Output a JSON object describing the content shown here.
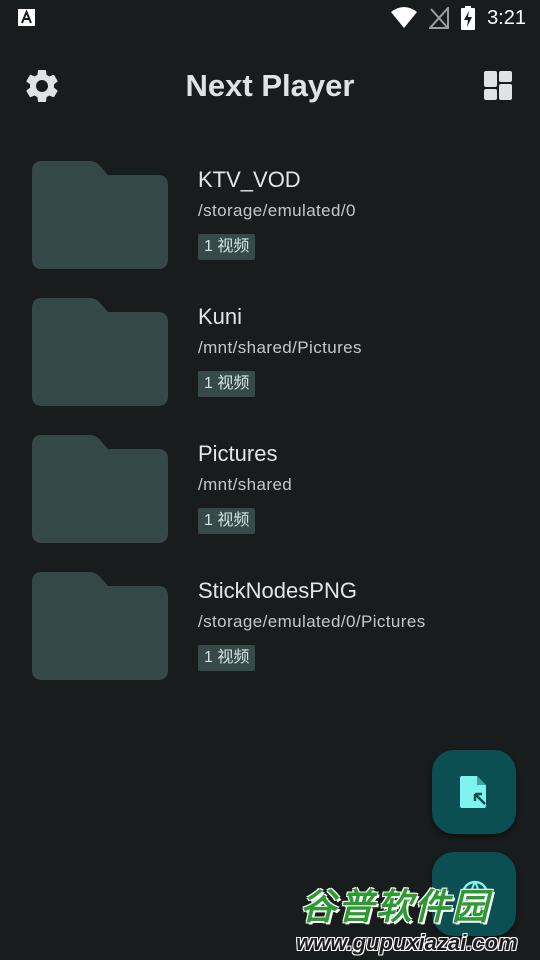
{
  "status_bar": {
    "time": "3:21",
    "left_icon": "font-a-icon",
    "right_icons": [
      "wifi-icon",
      "signal-off-icon",
      "battery-charging-icon"
    ]
  },
  "app_bar": {
    "title": "Next Player",
    "left_icon": "settings-icon",
    "right_icon": "dashboard-layout-icon"
  },
  "folders": [
    {
      "name": "KTV_VOD",
      "path": "/storage/emulated/0",
      "count": "1 视频"
    },
    {
      "name": "Kuni",
      "path": "/mnt/shared/Pictures",
      "count": "1 视频"
    },
    {
      "name": "Pictures",
      "path": "/mnt/shared",
      "count": "1 视频"
    },
    {
      "name": "StickNodesPNG",
      "path": "/storage/emulated/0/Pictures",
      "count": "1 视频"
    }
  ],
  "fab": {
    "primary_icon": "open-local-file-icon",
    "secondary_icon": "network-stream-icon"
  },
  "watermark": {
    "title": "谷普软件园",
    "url": "www.gupuxiazai.com"
  },
  "colors": {
    "background": "#191c1d",
    "folder": "#344848",
    "badge": "#374a4a",
    "fab": "#0b4f52",
    "fab_icon": "#7ff3f0"
  }
}
